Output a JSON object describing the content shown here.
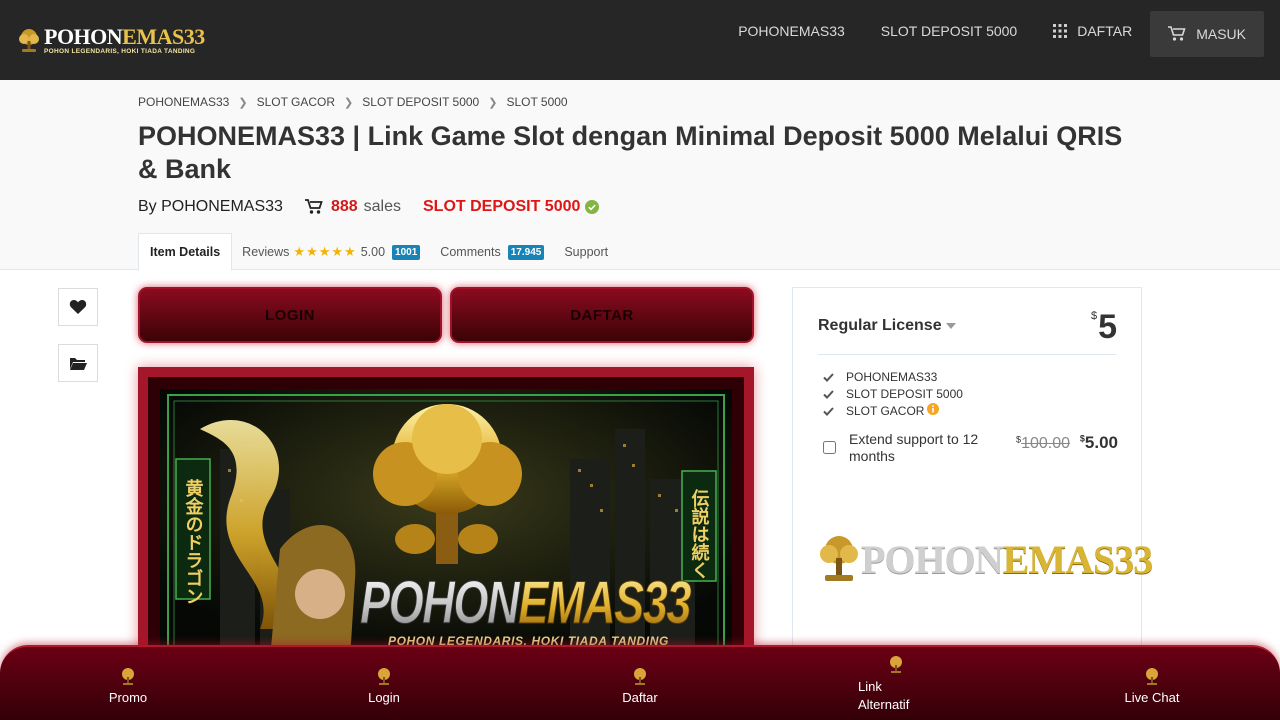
{
  "brand": {
    "logo_white": "POHON",
    "logo_gold": "EMAS33",
    "logo_tagline": "POHON LEGENDARIS, HOKI TIADA TANDING"
  },
  "nav": {
    "items": [
      {
        "label": "POHONEMAS33"
      },
      {
        "label": "SLOT DEPOSIT 5000"
      },
      {
        "label": "DAFTAR"
      },
      {
        "label": "MASUK"
      }
    ]
  },
  "breadcrumb": [
    "POHONEMAS33",
    "SLOT GACOR",
    "SLOT DEPOSIT 5000",
    "SLOT 5000"
  ],
  "title": "POHONEMAS33 | Link Game Slot dengan Minimal Deposit 5000 Melalui QRIS & Bank",
  "meta": {
    "by_prefix": "By",
    "author": "POHONEMAS33",
    "sales_count": "888",
    "sales_label": "sales",
    "category": "SLOT DEPOSIT 5000"
  },
  "tabs": {
    "item_details": "Item Details",
    "reviews": "Reviews",
    "stars": "★★★★★",
    "rating": "5.00",
    "reviews_count": "1001",
    "comments": "Comments",
    "comments_count": "17.945",
    "support": "Support"
  },
  "actions": {
    "login": "LOGIN",
    "daftar": "DAFTAR"
  },
  "banner": {
    "left_text": "黄金のドラゴン",
    "right_text": "伝説は続く",
    "logo_white": "POHON",
    "logo_gold": "EMAS33",
    "tagline": "POHON LEGENDARIS, HOKI TIADA TANDING"
  },
  "license": {
    "name": "Regular License",
    "currency": "$",
    "price": "5",
    "features": [
      "POHONEMAS33",
      "SLOT DEPOSIT 5000",
      "SLOT GACOR"
    ],
    "extend_label": "Extend support to 12 months",
    "old_price": "100.00",
    "new_price": "5.00",
    "logo_white": "POHON",
    "logo_gold": "EMAS33"
  },
  "bottom_bar": {
    "items": [
      {
        "label": "Promo"
      },
      {
        "label": "Login"
      },
      {
        "label": "Daftar"
      },
      {
        "label_line1": "Link",
        "label_line2": "Alternatif"
      },
      {
        "label": "Live Chat"
      }
    ]
  },
  "colors": {
    "topbar": "#262626",
    "accent_red": "#e01515",
    "gold": "#e8c24a",
    "bottom_bar": "#6b0014",
    "badge_blue": "#1a83b5"
  },
  "icons": [
    "tree-logo-icon",
    "grid-icon",
    "cart-icon",
    "verified-check-icon",
    "star-icon",
    "heart-icon",
    "folder-icon",
    "check-icon",
    "info-icon",
    "caret-down-icon"
  ]
}
